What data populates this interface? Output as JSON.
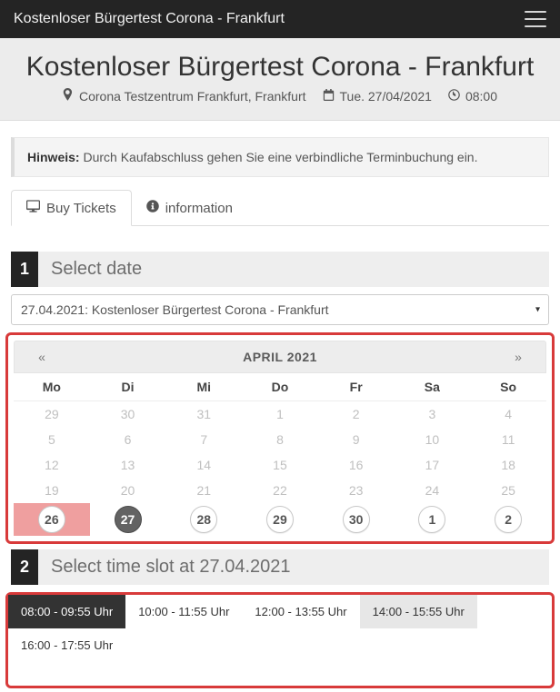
{
  "navbar": {
    "title": "Kostenloser Bürgertest Corona - Frankfurt"
  },
  "hero": {
    "title": "Kostenloser Bürgertest Corona - Frankfurt",
    "location": "Corona Testzentrum Frankfurt, Frankfurt",
    "date": "Tue. 27/04/2021",
    "time": "08:00"
  },
  "notice": {
    "label": "Hinweis:",
    "text": " Durch Kaufabschluss gehen Sie eine verbindliche Terminbuchung ein."
  },
  "tabs": {
    "buy": "Buy Tickets",
    "info": "information"
  },
  "step1": {
    "num": "1",
    "title": "Select date",
    "select_value": "27.04.2021: Kostenloser Bürgertest Corona - Frankfurt"
  },
  "calendar": {
    "prev": "«",
    "next": "»",
    "month": "APRIL 2021",
    "dow": [
      "Mo",
      "Di",
      "Mi",
      "Do",
      "Fr",
      "Sa",
      "So"
    ],
    "weeks": [
      [
        {
          "n": "29",
          "s": "dis"
        },
        {
          "n": "30",
          "s": "dis"
        },
        {
          "n": "31",
          "s": "dis"
        },
        {
          "n": "1",
          "s": "dis"
        },
        {
          "n": "2",
          "s": "dis"
        },
        {
          "n": "3",
          "s": "dis"
        },
        {
          "n": "4",
          "s": "dis"
        }
      ],
      [
        {
          "n": "5",
          "s": "dis"
        },
        {
          "n": "6",
          "s": "dis"
        },
        {
          "n": "7",
          "s": "dis"
        },
        {
          "n": "8",
          "s": "dis"
        },
        {
          "n": "9",
          "s": "dis"
        },
        {
          "n": "10",
          "s": "dis"
        },
        {
          "n": "11",
          "s": "dis"
        }
      ],
      [
        {
          "n": "12",
          "s": "dis"
        },
        {
          "n": "13",
          "s": "dis"
        },
        {
          "n": "14",
          "s": "dis"
        },
        {
          "n": "15",
          "s": "dis"
        },
        {
          "n": "16",
          "s": "dis"
        },
        {
          "n": "17",
          "s": "dis"
        },
        {
          "n": "18",
          "s": "dis"
        }
      ],
      [
        {
          "n": "19",
          "s": "dis"
        },
        {
          "n": "20",
          "s": "dis"
        },
        {
          "n": "21",
          "s": "dis"
        },
        {
          "n": "22",
          "s": "dis"
        },
        {
          "n": "23",
          "s": "dis"
        },
        {
          "n": "24",
          "s": "dis"
        },
        {
          "n": "25",
          "s": "dis"
        }
      ],
      [
        {
          "n": "26",
          "s": "past"
        },
        {
          "n": "27",
          "s": "selected"
        },
        {
          "n": "28",
          "s": "avail"
        },
        {
          "n": "29",
          "s": "avail"
        },
        {
          "n": "30",
          "s": "avail"
        },
        {
          "n": "1",
          "s": "avail"
        },
        {
          "n": "2",
          "s": "avail"
        }
      ]
    ]
  },
  "step2": {
    "num": "2",
    "title": "Select time slot at 27.04.2021"
  },
  "slots": [
    {
      "label": "08:00 - 09:55 Uhr",
      "state": "sel"
    },
    {
      "label": "10:00 - 11:55 Uhr",
      "state": "norm"
    },
    {
      "label": "12:00 - 13:55 Uhr",
      "state": "norm"
    },
    {
      "label": "14:00 - 15:55 Uhr",
      "state": "hl"
    },
    {
      "label": "16:00 - 17:55 Uhr",
      "state": "norm"
    }
  ]
}
